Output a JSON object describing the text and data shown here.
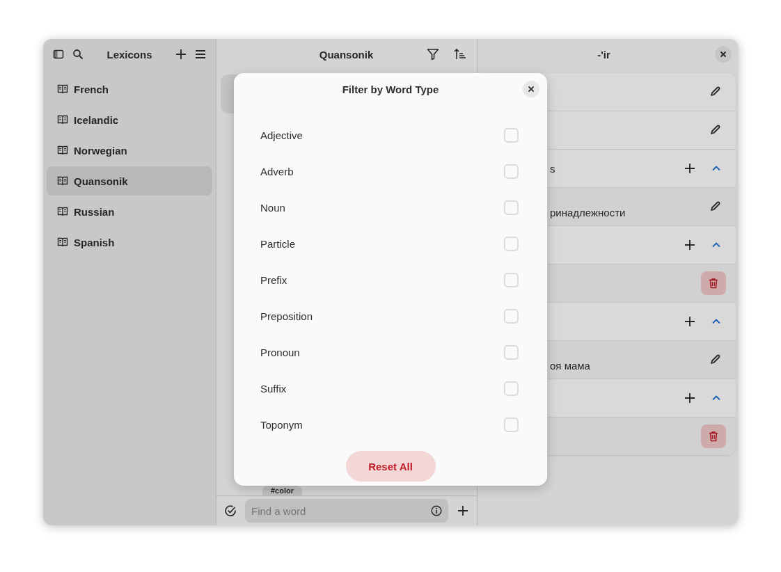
{
  "sidebar": {
    "title": "Lexicons",
    "items": [
      {
        "label": "French",
        "selected": false
      },
      {
        "label": "Icelandic",
        "selected": false
      },
      {
        "label": "Norwegian",
        "selected": false
      },
      {
        "label": "Quansonik",
        "selected": true
      },
      {
        "label": "Russian",
        "selected": false
      },
      {
        "label": "Spanish",
        "selected": false
      }
    ]
  },
  "word_list": {
    "title": "Quansonik",
    "tag": "#color",
    "search": {
      "placeholder": "Find a word"
    }
  },
  "detail": {
    "title": "-'ir",
    "rows": [
      {
        "kind": "field"
      },
      {
        "kind": "field"
      },
      {
        "kind": "section",
        "text": "s",
        "expanded": true
      },
      {
        "kind": "entry-edit",
        "text": "ринадлежности"
      },
      {
        "kind": "section",
        "expanded": true
      },
      {
        "kind": "entry-delete"
      },
      {
        "kind": "section",
        "expanded": true
      },
      {
        "kind": "entry-edit",
        "text": "оя мама"
      },
      {
        "kind": "section",
        "expanded": true
      },
      {
        "kind": "entry-delete"
      }
    ]
  },
  "dialog": {
    "title": "Filter by Word Type",
    "options": [
      {
        "label": "Adjective",
        "checked": false
      },
      {
        "label": "Adverb",
        "checked": false
      },
      {
        "label": "Noun",
        "checked": false
      },
      {
        "label": "Particle",
        "checked": false
      },
      {
        "label": "Prefix",
        "checked": false
      },
      {
        "label": "Preposition",
        "checked": false
      },
      {
        "label": "Pronoun",
        "checked": false
      },
      {
        "label": "Suffix",
        "checked": false
      },
      {
        "label": "Toponym",
        "checked": false
      }
    ],
    "reset_button": "Reset All"
  }
}
